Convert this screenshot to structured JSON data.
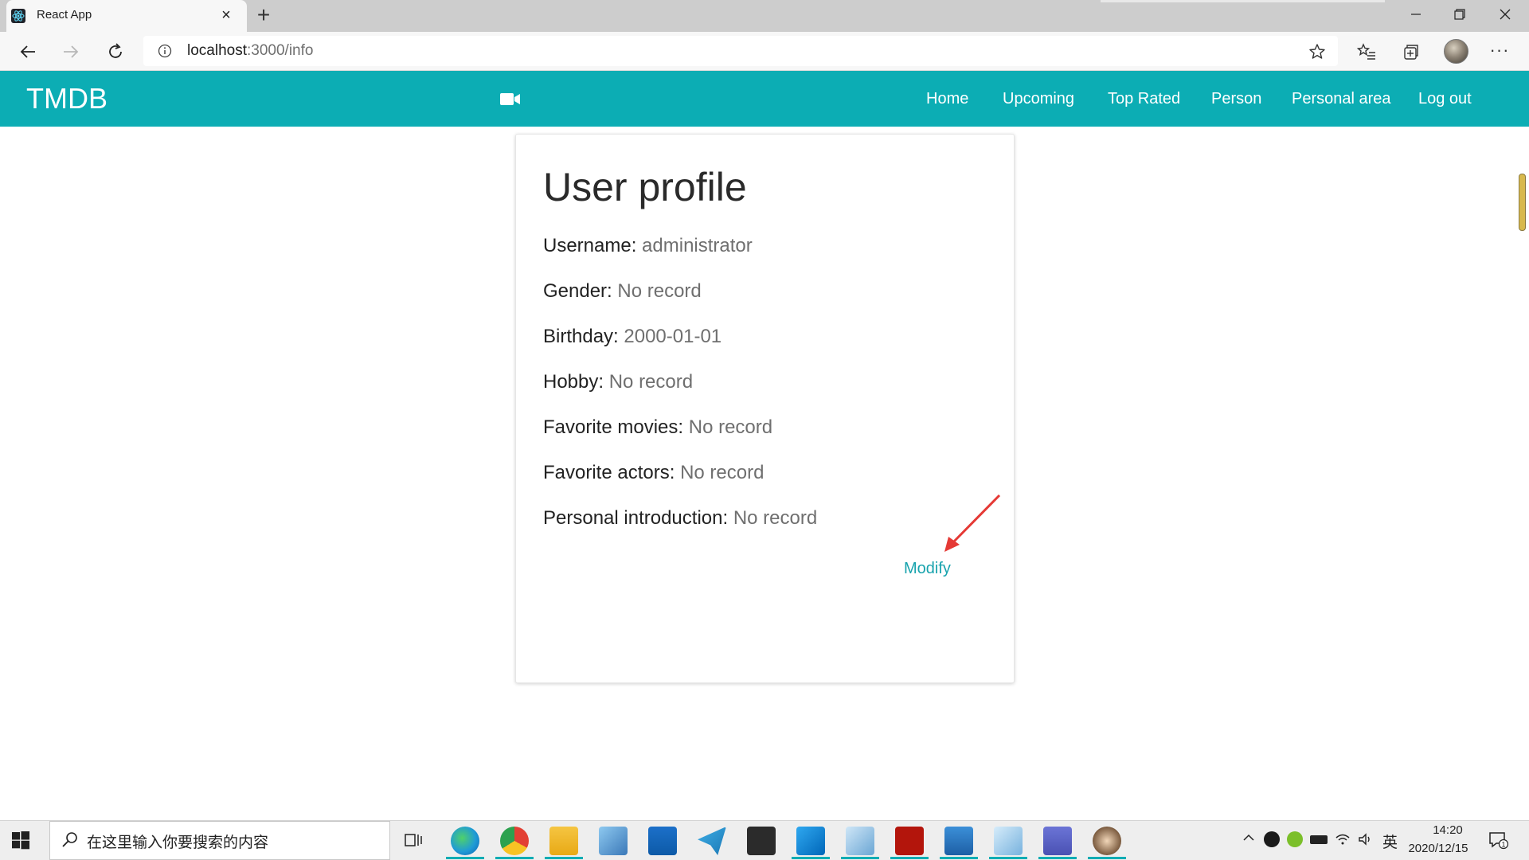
{
  "browser": {
    "tab_title": "React App",
    "url_host": "localhost",
    "url_path": ":3000/info",
    "icons": [
      "react-favicon",
      "back-arrow-icon",
      "forward-arrow-icon",
      "refresh-icon",
      "info-icon",
      "star-icon",
      "favorites-icon",
      "collections-icon",
      "more-icon"
    ]
  },
  "navbar": {
    "brand": "TMDB",
    "icon": "video-camera-icon",
    "links": [
      "Home",
      "Upcoming",
      "Top Rated",
      "Person",
      "Personal area",
      "Log out"
    ],
    "color": "#0cadb4"
  },
  "profile": {
    "title": "User profile",
    "fields": [
      {
        "label": "Username:",
        "value": "administrator"
      },
      {
        "label": "Gender:",
        "value": "No record"
      },
      {
        "label": "Birthday:",
        "value": "2000-01-01"
      },
      {
        "label": "Hobby:",
        "value": "No record"
      },
      {
        "label": "Favorite movies:",
        "value": "No record"
      },
      {
        "label": "Favorite actors:",
        "value": "No record"
      },
      {
        "label": "Personal introduction:",
        "value": "No record"
      }
    ],
    "modify_label": "Modify",
    "link_color": "#18a3ad"
  },
  "taskbar": {
    "search_placeholder": "在这里输入你要搜索的内容",
    "ime": "英",
    "time": "14:20",
    "date": "2020/12/15",
    "notification_count": "1",
    "apps": [
      "edge",
      "chrome",
      "file-explorer",
      "remote-desktop",
      "mail",
      "telegram",
      "store",
      "vscode",
      "notepad",
      "acrobat",
      "photos",
      "notepad2",
      "teams",
      "app-avatar"
    ]
  }
}
